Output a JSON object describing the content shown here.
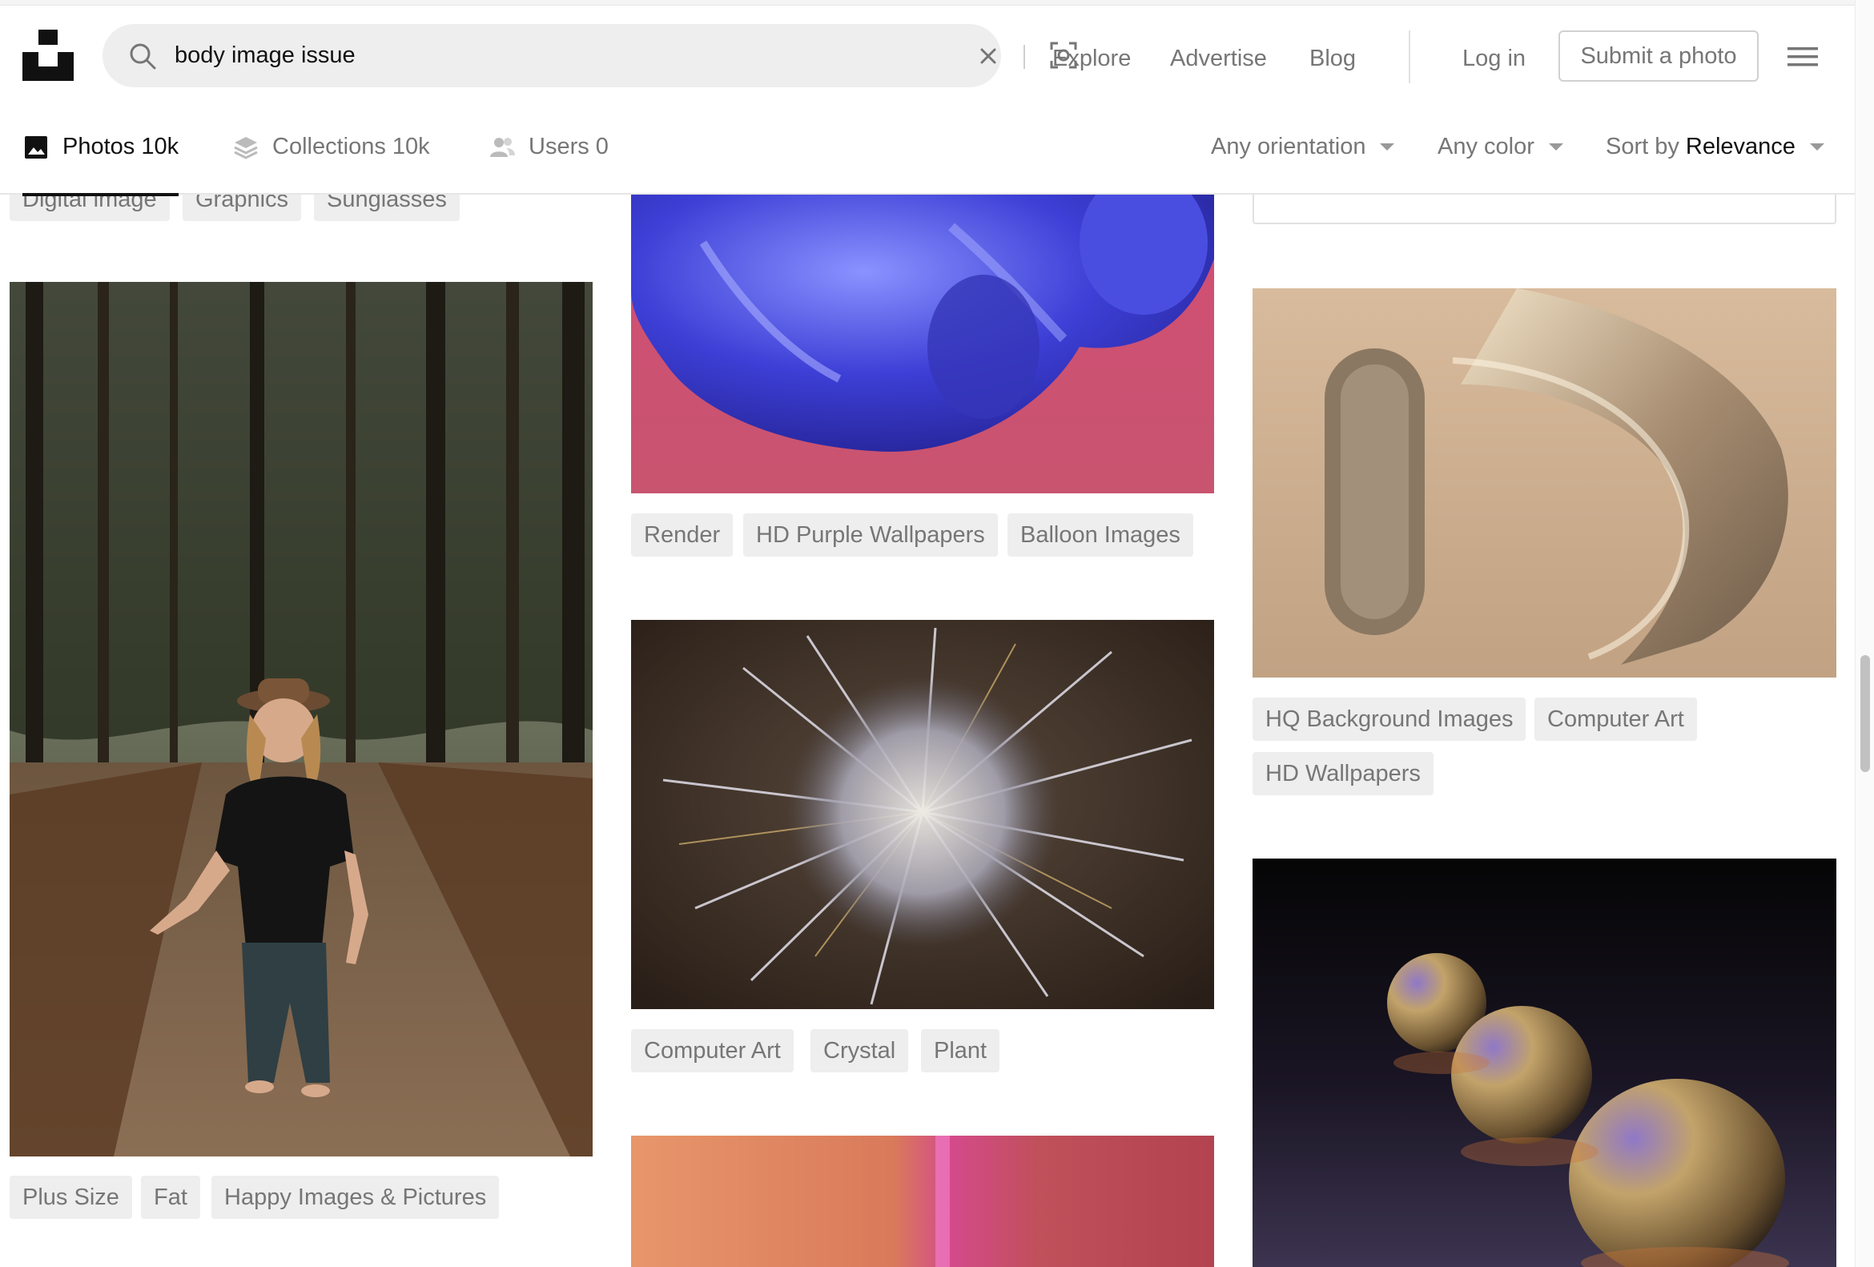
{
  "search": {
    "query": "body image issue",
    "icon": "search-icon",
    "clear_icon": "close-icon",
    "visual_search_icon": "visual-search-icon"
  },
  "nav": {
    "explore": "Explore",
    "advertise": "Advertise",
    "blog": "Blog",
    "login": "Log in",
    "submit": "Submit a photo",
    "menu_icon": "hamburger-menu-icon"
  },
  "tabs": [
    {
      "label": "Photos 10k",
      "icon": "image-icon",
      "active": true
    },
    {
      "label": "Collections 10k",
      "icon": "collections-icon",
      "active": false
    },
    {
      "label": "Users 0",
      "icon": "users-icon",
      "active": false
    }
  ],
  "filters": {
    "orientation": "Any orientation",
    "color": "Any color",
    "sort_prefix": "Sort by",
    "sort_value": "Relevance"
  },
  "columns": {
    "left": {
      "top_tags": [
        "Digital image",
        "Graphics",
        "Sunglasses"
      ],
      "photo_tags": [
        "Plus Size",
        "Fat",
        "Happy Images & Pictures"
      ]
    },
    "middle": {
      "photo1_tags": [
        "Render",
        "HD Purple Wallpapers",
        "Balloon Images"
      ],
      "photo2_tags": [
        "Computer Art",
        "Crystal",
        "Plant"
      ]
    },
    "right": {
      "photo1_tags": [
        "HQ Background Images",
        "Computer Art",
        "HD Wallpapers"
      ]
    }
  },
  "colors": {
    "accent": "#111111",
    "muted_text": "#767676",
    "tag_bg": "#eeeeee",
    "search_bg": "#eeeeee"
  }
}
